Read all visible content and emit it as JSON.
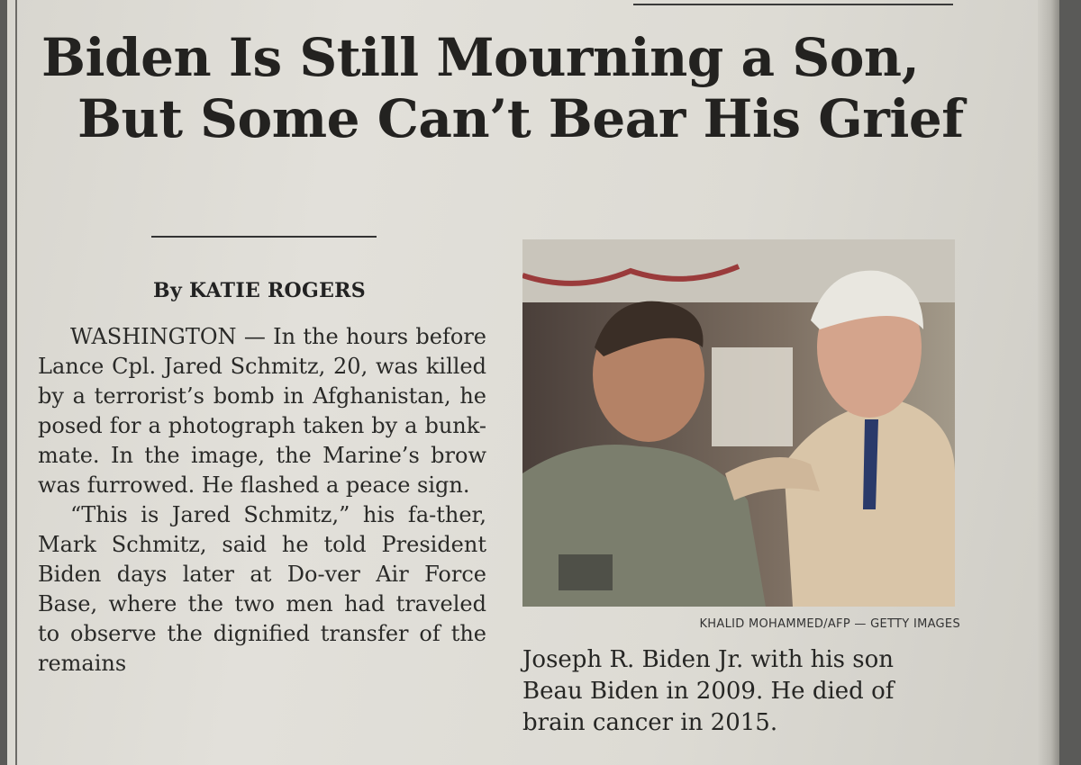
{
  "headline": {
    "line1": "Biden Is Still Mourning a Son,",
    "line2": "But Some Can’t Bear His Grief"
  },
  "byline": "By KATIE ROGERS",
  "article": {
    "paragraphs": [
      "WASHINGTON — In the hours before Lance Cpl. Jared Schmitz, 20, was killed by a terrorist’s bomb in Afghanistan, he posed for a photograph taken by a bunk-mate. In the image, the Marine’s brow was furrowed. He flashed a peace sign.",
      "“This is Jared Schmitz,” his fa-ther, Mark Schmitz, said he told President Biden days later at Do-ver Air Force Base, where the two men had traveled to observe the dignified transfer of the remains"
    ]
  },
  "photo": {
    "credit": "KHALID MOHAMMED/AFP — GETTY IMAGES",
    "caption": "Joseph R. Biden Jr. with his son Beau Biden in 2009. He died of brain cancer in 2015."
  }
}
